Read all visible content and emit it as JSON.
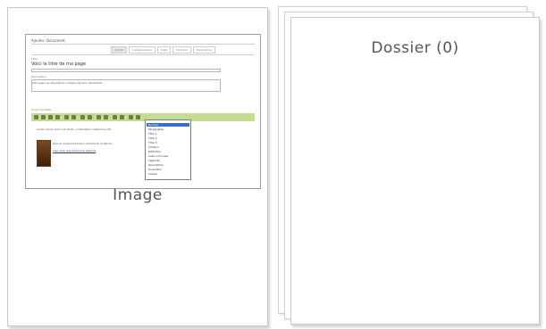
{
  "image_card": {
    "label": "Image",
    "thumbnail": {
      "window_title": "Ajouter: Document",
      "tabs": [
        "Défaut",
        "Catégorisation",
        "Date",
        "Création",
        "Paramètres"
      ],
      "active_tab": "Défaut",
      "title_caption": "Titre",
      "title_value": "Voici le titre de ma page",
      "description_caption": "Description",
      "description_value": "Voici aussi un résumé du contenu de mon document",
      "body_caption": "Corps du texte",
      "dropdown_items": [
        "Normal",
        "Paragraphe",
        "Titre 1",
        "Titre 2",
        "Titre 3",
        "Citation",
        "Définition",
        "Liste ordonnée",
        "Légende",
        "Description",
        "Sous-titre",
        "Insérer"
      ],
      "body_text": "Lorem ipsum dolor sit amet, consectetur adipiscing elit.",
      "body_text_2": "Sed do eiusmod tempor incididunt ut labore",
      "link_text": "Lien vers une ressource externe"
    }
  },
  "folder_card": {
    "label": "Dossier (0)"
  }
}
